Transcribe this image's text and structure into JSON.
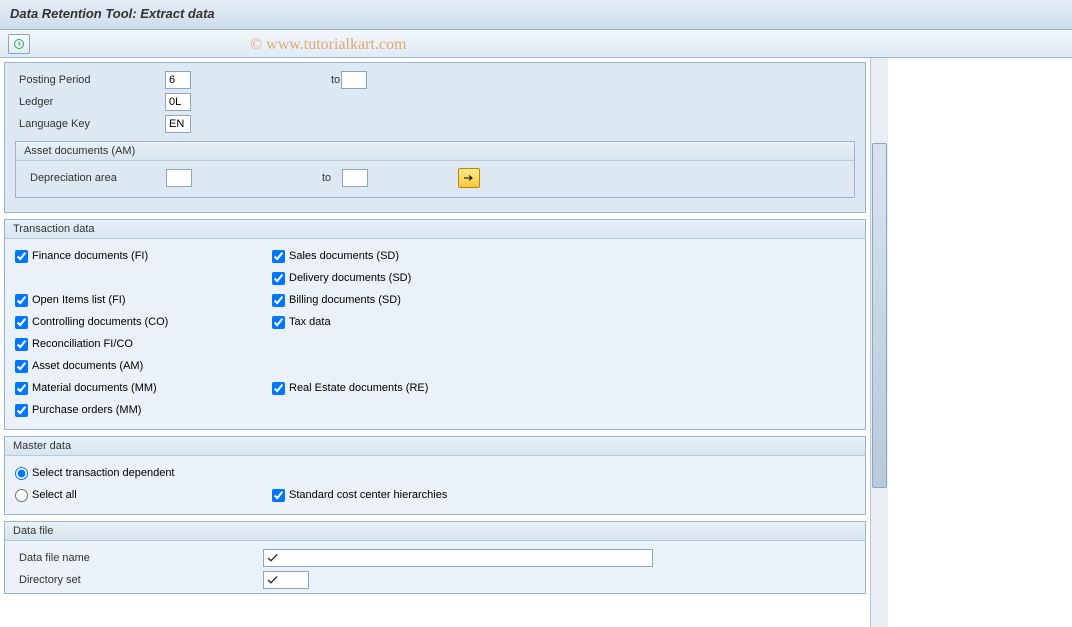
{
  "title": "Data Retention Tool: Extract data",
  "watermark": "© www.tutorialkart.com",
  "top": {
    "posting_period_label": "Posting Period",
    "posting_period_value": "6",
    "to_label": "to",
    "posting_period_to": "",
    "ledger_label": "Ledger",
    "ledger_value": "0L",
    "language_label": "Language Key",
    "language_value": "EN"
  },
  "asset": {
    "heading": "Asset documents (AM)",
    "depr_label": "Depreciation area",
    "depr_from": "",
    "to_label": "to",
    "depr_to": ""
  },
  "trans": {
    "heading": "Transaction data",
    "fi": "Finance documents (FI)",
    "sales": "Sales documents (SD)",
    "delivery": "Delivery documents (SD)",
    "open": "Open Items list (FI)",
    "billing": "Billing documents (SD)",
    "co": "Controlling documents (CO)",
    "tax": "Tax data",
    "recon": "Reconciliation FI/CO",
    "assetam": "Asset documents (AM)",
    "mat": "Material documents (MM)",
    "re": "Real Estate documents (RE)",
    "po": "Purchase orders (MM)"
  },
  "master": {
    "heading": "Master data",
    "opt1": "Select transaction dependent",
    "opt2": "Select all",
    "std": "Standard cost center hierarchies"
  },
  "file": {
    "heading": "Data file",
    "name_label": "Data file name",
    "name_value": "",
    "dir_label": "Directory set",
    "dir_value": ""
  }
}
